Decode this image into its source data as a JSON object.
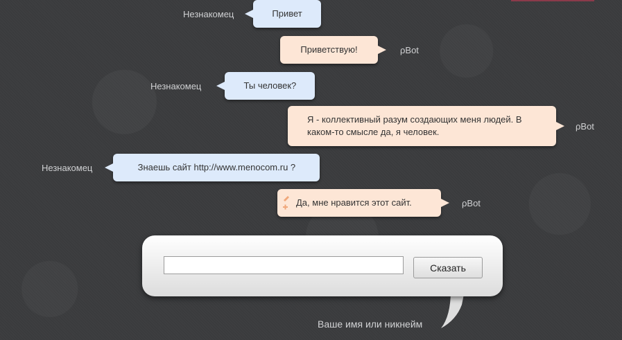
{
  "messages": [
    {
      "author": "Незнакомец",
      "role": "user",
      "text": "Привет"
    },
    {
      "author": "ρBot",
      "role": "bot",
      "text": "Приветствую!"
    },
    {
      "author": "Незнакомец",
      "role": "user",
      "text": "Ты человек?"
    },
    {
      "author": "ρBot",
      "role": "bot",
      "text_lines": [
        "Я - коллективный разум создающих меня людей. В",
        "каком-то смысле да, я человек."
      ]
    },
    {
      "author": "Незнакомец",
      "role": "user",
      "text": "Знаешь сайт http://www.menocom.ru ?"
    },
    {
      "author": "ρBot",
      "role": "bot",
      "text": "Да, мне нравится этот сайт."
    }
  ],
  "input": {
    "value": "",
    "placeholder": ""
  },
  "say_button": "Сказать",
  "name_hint": "Ваше имя или никнейм",
  "colors": {
    "user_bubble": "#ddeafb",
    "bot_bubble": "#fde6d6",
    "background": "#3d3e40"
  },
  "icons": [
    "edit-icon"
  ]
}
